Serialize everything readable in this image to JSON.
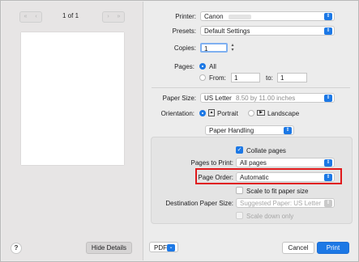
{
  "left": {
    "nav_first": "«",
    "nav_prev": "‹",
    "nav_next": "›",
    "nav_last": "»",
    "page_indicator": "1 of 1",
    "help_label": "?",
    "hide_details_label": "Hide Details"
  },
  "printer": {
    "label": "Printer:",
    "value": "Canon"
  },
  "presets": {
    "label": "Presets:",
    "value": "Default Settings"
  },
  "copies": {
    "label": "Copies:",
    "value": "1"
  },
  "pages": {
    "label": "Pages:",
    "all_label": "All",
    "from_label": "From:",
    "from_value": "1",
    "to_label": "to:",
    "to_value": "1"
  },
  "paper_size": {
    "label": "Paper Size:",
    "value": "US Letter",
    "detail": "8.50 by 11.00 inches"
  },
  "orientation": {
    "label": "Orientation:",
    "portrait_label": "Portrait",
    "landscape_label": "Landscape"
  },
  "section": {
    "value": "Paper Handling"
  },
  "paper_handling": {
    "collate_label": "Collate pages",
    "pages_to_print_label": "Pages to Print:",
    "pages_to_print_value": "All pages",
    "page_order_label": "Page Order:",
    "page_order_value": "Automatic",
    "scale_label": "Scale to fit paper size",
    "dest_label": "Destination Paper Size:",
    "dest_value": "Suggested Paper: US Letter",
    "scale_down_label": "Scale down only"
  },
  "bottom": {
    "pdf_label": "PDF",
    "cancel_label": "Cancel",
    "print_label": "Print"
  },
  "colors": {
    "accent": "#1c78e5",
    "highlight": "#e0191b"
  }
}
